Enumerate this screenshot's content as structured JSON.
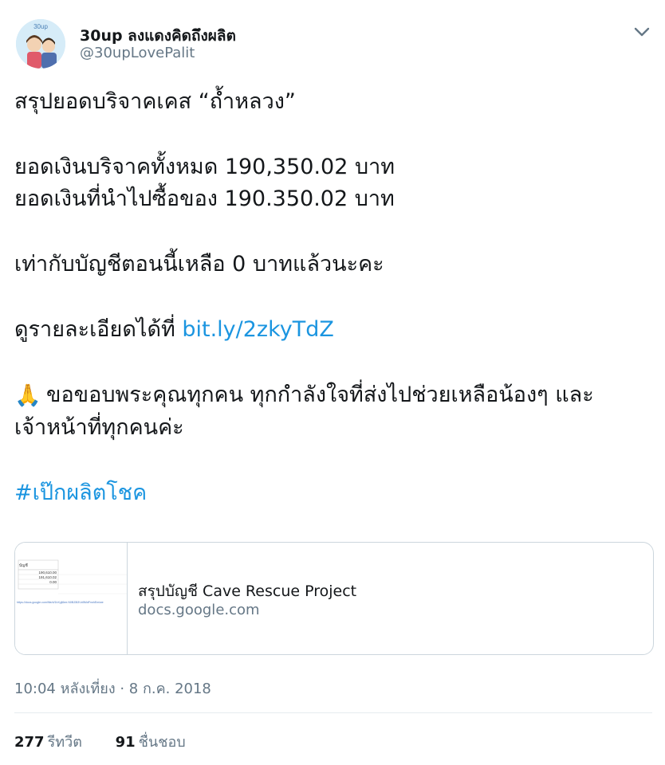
{
  "user": {
    "display_name": "30up ลงแดงคิดถึงผลิต",
    "handle": "@30upLovePalit",
    "avatar_text": "30up"
  },
  "tweet": {
    "line1": "สรุปยอดบริจาคเคส “ถ้ำหลวง”",
    "line2": "ยอดเงินบริจาคทั้งหมด 190,350.02 บาท",
    "line3": "ยอดเงินที่นำไปซื้อของ 190.350.02 บาท",
    "line4": "เท่ากับบัญชีตอนนี้เหลือ 0 บาทแล้วนะคะ",
    "line5_prefix": "ดูรายละเอียดได้ที่ ",
    "line5_link": "bit.ly/2zkyTdZ",
    "line6_emoji": "🙏",
    "line6": "ขอขอบพระคุณทุกคน ทุกกำลังใจที่ส่งไปช่วยเหลือน้องๆ และ",
    "line7": "เจ้าหน้าที่ทุกคนค่ะ",
    "hashtag": "#เป๊กผลิตโชค"
  },
  "card": {
    "title": "สรุปบัญชี Cave Rescue Project",
    "domain": "docs.google.com",
    "thumb_header": "บัญชี",
    "thumb_val1": "190,610.00",
    "thumb_val2": "191,610.02",
    "thumb_val3": "0.00",
    "thumb_url": "https://docs.google.com/file/d/1bXyjl6ee.N0BZ8i3VzBMdFrwhEmiwe"
  },
  "meta": {
    "timestamp": "10:04 หลังเที่ยง · 8 ก.ค. 2018"
  },
  "stats": {
    "retweets_count": "277",
    "retweets_label": "รีทวีต",
    "likes_count": "91",
    "likes_label": "ชื่นชอบ"
  }
}
